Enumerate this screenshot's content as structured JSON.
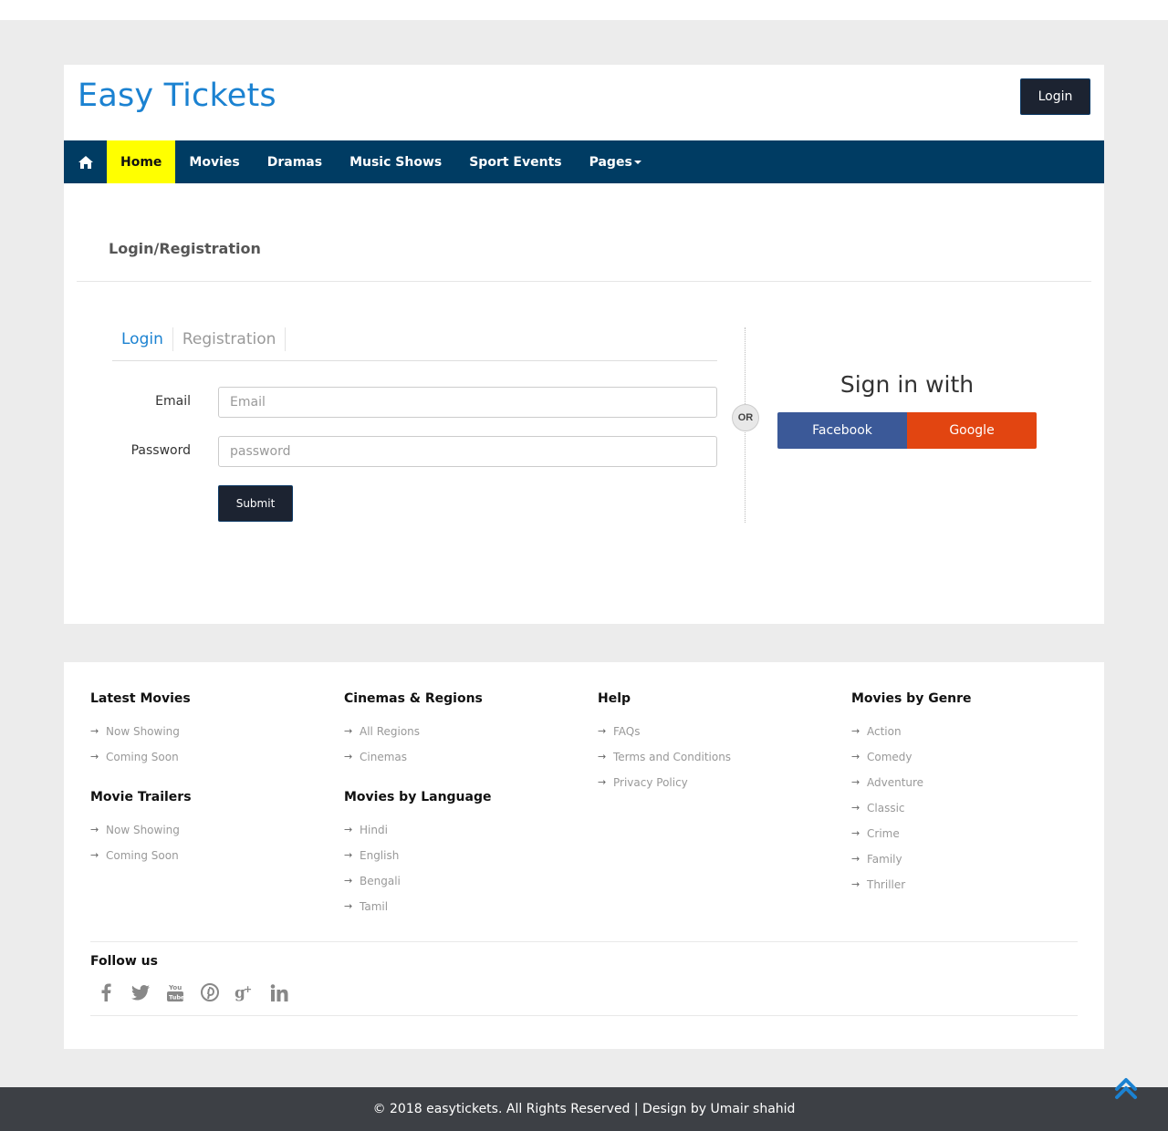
{
  "header": {
    "brand": "Easy Tickets",
    "login_button": "Login"
  },
  "nav": {
    "home_icon": "home-icon",
    "items": [
      {
        "label": "Home",
        "active": true
      },
      {
        "label": "Movies"
      },
      {
        "label": "Dramas"
      },
      {
        "label": "Music Shows"
      },
      {
        "label": "Sport Events"
      },
      {
        "label": "Pages"
      }
    ]
  },
  "page": {
    "title": "Login/Registration",
    "tabs": [
      "Login",
      "Registration"
    ],
    "form": {
      "email_label": "Email",
      "email_placeholder": "Email",
      "password_label": "Password",
      "password_placeholder": "password",
      "submit": "Submit"
    },
    "or_label": "OR",
    "signin_with": "Sign in with",
    "facebook": "Facebook",
    "google": "Google",
    "colors": {
      "facebook": "#3b5998",
      "google": "#e24511",
      "brand": "#1b82d1",
      "nav": "#003c63",
      "nav_active": "#ffff00"
    }
  },
  "footer": {
    "columns": [
      {
        "heading": "Latest Movies",
        "links": [
          "Now Showing",
          "Coming Soon"
        ],
        "heading2": "Movie Trailers",
        "links2": [
          "Now Showing",
          "Coming Soon"
        ]
      },
      {
        "heading": "Cinemas & Regions",
        "links": [
          "All Regions",
          "Cinemas"
        ],
        "heading2": "Movies by Language",
        "links2": [
          "Hindi",
          "English",
          "Bengali",
          "Tamil"
        ]
      },
      {
        "heading": "Help",
        "links": [
          "FAQs",
          "Terms and Conditions",
          "Privacy Policy"
        ]
      },
      {
        "heading": "Movies by Genre",
        "links": [
          "Action",
          "Comedy",
          "Adventure",
          "Classic",
          "Crime",
          "Family",
          "Thriller"
        ]
      }
    ],
    "follow_us": "Follow us",
    "social_icons": [
      "facebook-icon",
      "twitter-icon",
      "youtube-icon",
      "pinterest-icon",
      "google-plus-icon",
      "linkedin-icon"
    ]
  },
  "bottom": {
    "copyright": "© 2018 easytickets. All Rights Reserved | Design by Umair shahid"
  }
}
